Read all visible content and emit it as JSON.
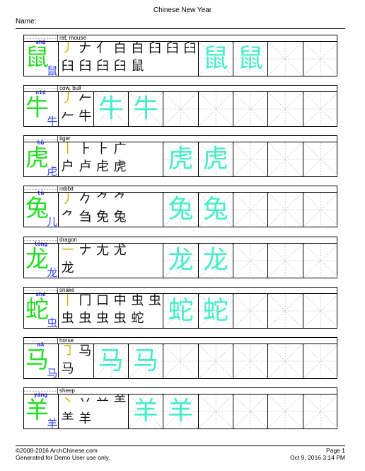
{
  "document": {
    "title": "Chinese New Year",
    "name_label": "Name:"
  },
  "worksheet": {
    "traced_copies": 2,
    "colors": {
      "main_character": "#22dd22",
      "radical": "#3344ff",
      "traced_character": "#44eec8",
      "current_stroke": "#c8b400",
      "completed_strokes": "#111111",
      "pinyin": "#1a1aff",
      "guide_lines": "#c8c8c8"
    },
    "entries": [
      {
        "pinyin": "shǔ",
        "meaning": "rat, mouse",
        "character": "鼠",
        "radical": "鼠",
        "stroke_steps": [
          "丿",
          "𠂇",
          "亻",
          "白",
          "白",
          "臼",
          "臼",
          "臼",
          "臼",
          "臼",
          "臼",
          "臼",
          "鼠"
        ]
      },
      {
        "pinyin": "niú",
        "meaning": "cow, bull",
        "character": "牛",
        "radical": "牛",
        "stroke_steps": [
          "丿",
          "𠂉",
          "𠂉",
          "牛"
        ]
      },
      {
        "pinyin": "hǔ",
        "meaning": "tiger",
        "character": "虎",
        "radical": "虍",
        "stroke_steps": [
          "丨",
          "⺊",
          "⺊",
          "广",
          "户",
          "卢",
          "虍",
          "虎"
        ]
      },
      {
        "pinyin": "tù",
        "meaning": "rabbit",
        "character": "兔",
        "radical": "儿",
        "stroke_steps": [
          "丿",
          "𠂊",
          "⺈",
          "⺈",
          "⺈",
          "刍",
          "免",
          "兔"
        ]
      },
      {
        "pinyin": "lóng",
        "meaning": "dragon",
        "character": "龙",
        "radical": "龙",
        "stroke_steps": [
          "一",
          "ナ",
          "尢",
          "尤",
          "龙"
        ]
      },
      {
        "pinyin": "shé",
        "meaning": "snake",
        "character": "蛇",
        "radical": "虫",
        "stroke_steps": [
          "丨",
          "冂",
          "口",
          "中",
          "虫",
          "虫",
          "虫",
          "虫",
          "虫",
          "虫",
          "蛇"
        ]
      },
      {
        "pinyin": "mǎ",
        "meaning": "horse",
        "character": "马",
        "radical": "马",
        "stroke_steps": [
          "㇆",
          "马",
          "马"
        ]
      },
      {
        "pinyin": "yáng",
        "meaning": "sheep",
        "character": "羊",
        "radical": "羊",
        "stroke_steps": [
          "丶",
          "丷",
          "䒑",
          "⺷",
          "⺷",
          "羊"
        ]
      }
    ]
  },
  "footer": {
    "copyright": "©2008-2016 ArchChinese.com",
    "generated_note": "Generated for Demo User use only.",
    "page_label": "Page 1",
    "timestamp": "Oct 9, 2016 3:14 PM"
  }
}
